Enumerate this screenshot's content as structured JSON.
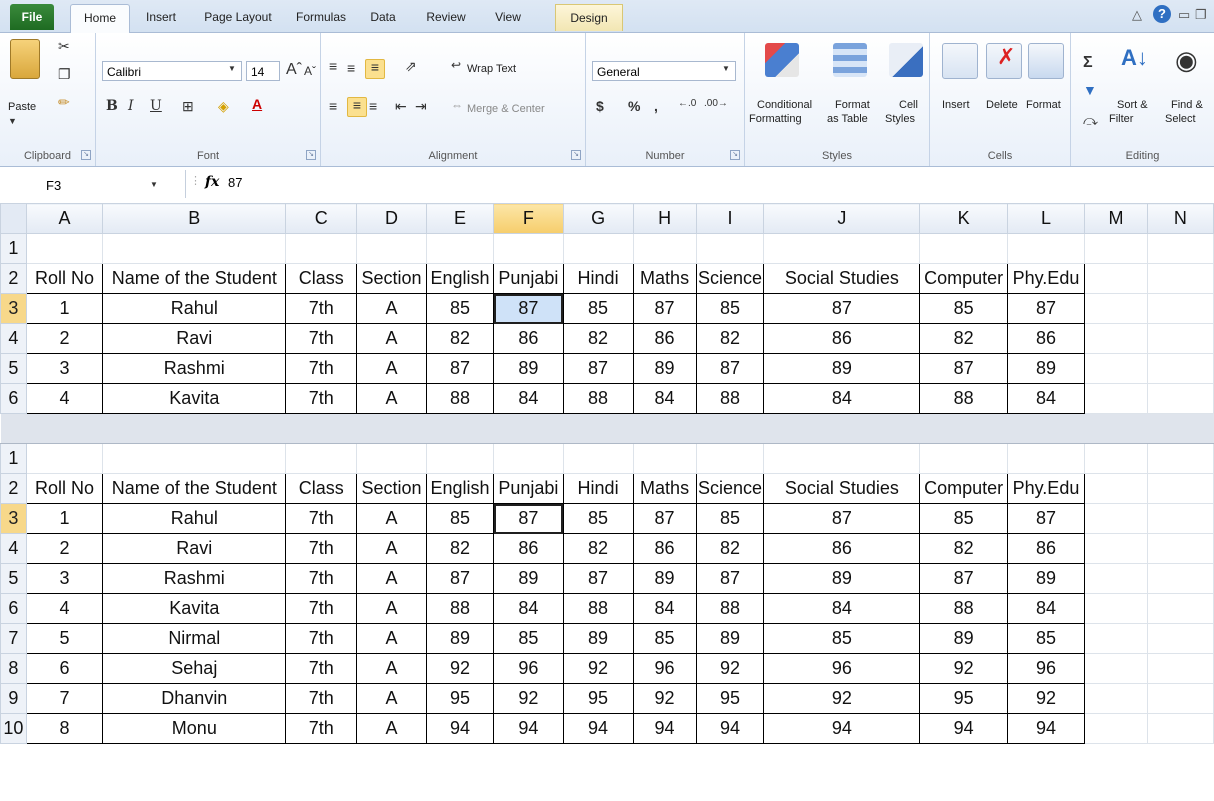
{
  "tabs": {
    "file": "File",
    "home": "Home",
    "insert": "Insert",
    "page_layout": "Page Layout",
    "formulas": "Formulas",
    "data": "Data",
    "review": "Review",
    "view": "View",
    "design": "Design"
  },
  "ribbon": {
    "clipboard": {
      "paste": "Paste",
      "label": "Clipboard"
    },
    "font": {
      "name": "Calibri",
      "size": "14",
      "bold": "B",
      "italic": "I",
      "underline": "U",
      "label": "Font"
    },
    "alignment": {
      "wrap_text": "Wrap Text",
      "merge_center": "Merge & Center",
      "label": "Alignment"
    },
    "number": {
      "format": "General",
      "currency": "$",
      "percent": "%",
      "comma": ",",
      "label": "Number"
    },
    "styles": {
      "conditional": "Conditional",
      "conditional2": "Formatting",
      "format_table": "Format",
      "format_table2": "as Table",
      "cell_styles": "Cell",
      "cell_styles2": "Styles",
      "label": "Styles"
    },
    "cells": {
      "insert": "Insert",
      "delete": "Delete",
      "format": "Format",
      "label": "Cells"
    },
    "editing": {
      "sort": "Sort &",
      "sort2": "Filter",
      "find": "Find &",
      "find2": "Select",
      "label": "Editing"
    }
  },
  "formula_bar": {
    "name_box": "F3",
    "fx": "fx",
    "value": "87"
  },
  "columns": [
    "A",
    "B",
    "C",
    "D",
    "E",
    "F",
    "G",
    "H",
    "I",
    "J",
    "K",
    "L",
    "M",
    "N"
  ],
  "headers": [
    "Roll No",
    "Name of the Student",
    "Class",
    "Section",
    "English",
    "Punjabi",
    "Hindi",
    "Maths",
    "Science",
    "Social Studies",
    "Computer",
    "Phy.Edu"
  ],
  "pane1": {
    "row_numbers": [
      "1",
      "2",
      "3",
      "4",
      "5",
      "6"
    ],
    "rows": [
      [
        "1",
        "Rahul",
        "7th",
        "A",
        "85",
        "87",
        "85",
        "87",
        "85",
        "87",
        "85",
        "87"
      ],
      [
        "2",
        "Ravi",
        "7th",
        "A",
        "82",
        "86",
        "82",
        "86",
        "82",
        "86",
        "82",
        "86"
      ],
      [
        "3",
        "Rashmi",
        "7th",
        "A",
        "87",
        "89",
        "87",
        "89",
        "87",
        "89",
        "87",
        "89"
      ],
      [
        "4",
        "Kavita",
        "7th",
        "A",
        "88",
        "84",
        "88",
        "84",
        "88",
        "84",
        "88",
        "84"
      ]
    ]
  },
  "pane2": {
    "row_numbers": [
      "1",
      "2",
      "3",
      "4",
      "5",
      "6",
      "7",
      "8",
      "9",
      "10"
    ],
    "rows": [
      [
        "1",
        "Rahul",
        "7th",
        "A",
        "85",
        "87",
        "85",
        "87",
        "85",
        "87",
        "85",
        "87"
      ],
      [
        "2",
        "Ravi",
        "7th",
        "A",
        "82",
        "86",
        "82",
        "86",
        "82",
        "86",
        "82",
        "86"
      ],
      [
        "3",
        "Rashmi",
        "7th",
        "A",
        "87",
        "89",
        "87",
        "89",
        "87",
        "89",
        "87",
        "89"
      ],
      [
        "4",
        "Kavita",
        "7th",
        "A",
        "88",
        "84",
        "88",
        "84",
        "88",
        "84",
        "88",
        "84"
      ],
      [
        "5",
        "Nirmal",
        "7th",
        "A",
        "89",
        "85",
        "89",
        "85",
        "89",
        "85",
        "89",
        "85"
      ],
      [
        "6",
        "Sehaj",
        "7th",
        "A",
        "92",
        "96",
        "92",
        "96",
        "92",
        "96",
        "92",
        "96"
      ],
      [
        "7",
        "Dhanvin",
        "7th",
        "A",
        "95",
        "92",
        "95",
        "92",
        "95",
        "92",
        "95",
        "92"
      ],
      [
        "8",
        "Monu",
        "7th",
        "A",
        "94",
        "94",
        "94",
        "94",
        "94",
        "94",
        "94",
        "94"
      ]
    ]
  },
  "active_cell": {
    "row": 3,
    "col": "F"
  }
}
